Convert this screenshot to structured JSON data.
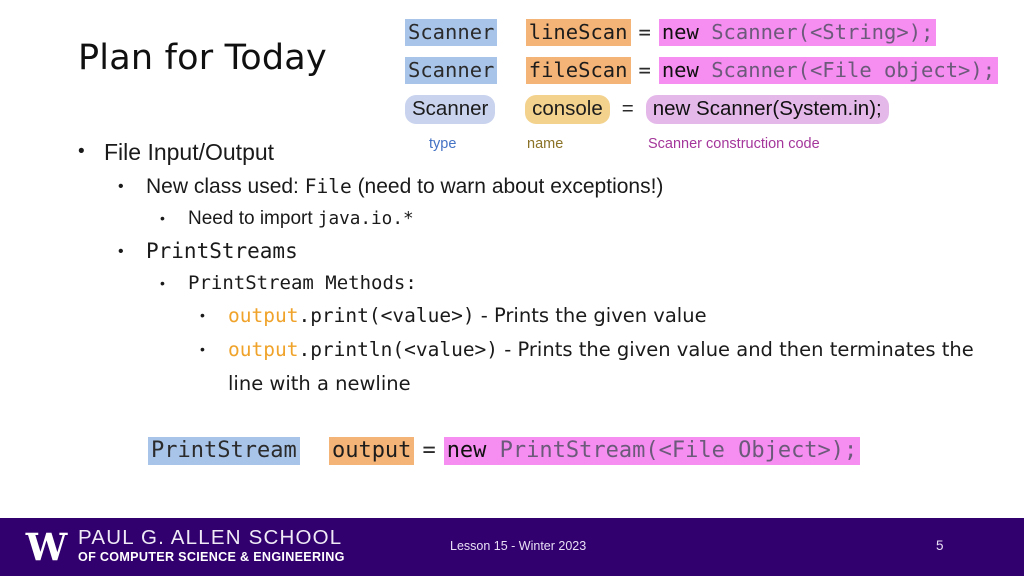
{
  "slide": {
    "title": "Plan for Today",
    "page_number": "5",
    "background_color": "#ffffff"
  },
  "code_diagram": {
    "rows": [
      {
        "type": "Scanner",
        "name": "lineScan",
        "equals": "=",
        "code_keyword": "new ",
        "code_rest": "Scanner(<String>);",
        "style": "mono"
      },
      {
        "type": "Scanner",
        "name": "fileScan",
        "equals": "=",
        "code_keyword": "new ",
        "code_rest": "Scanner(<File object>);",
        "style": "mono"
      },
      {
        "type": "Scanner",
        "name": "console",
        "equals": "=",
        "code_keyword": "new ",
        "code_rest": "Scanner(System.in);",
        "style": "sans"
      }
    ],
    "legend": {
      "type_label": "type",
      "name_label": "name",
      "code_label": "Scanner construction code",
      "type_color": "#4472c4",
      "name_color": "#8a7227",
      "code_color": "#a4369b"
    },
    "colors": {
      "type_highlight": "#a9c4e9",
      "name_highlight": "#f5b477",
      "code_highlight": "#f68df0",
      "type_highlight_soft": "#c9d3ee",
      "name_highlight_soft": "#f3d28e",
      "code_highlight_soft": "#e5b8ea"
    }
  },
  "bullets": {
    "b1_text": "File Input/Output",
    "b2_pre": "New class used: ",
    "b2_code": "File",
    "b2_post": " (need to warn about exceptions!)",
    "b3_pre": "Need to import ",
    "b3_code": "java.io.*",
    "b4_text": "PrintStreams",
    "b5_text": "PrintStream Methods:",
    "b6_out": "output",
    "b6_sig": ".print(<value>)",
    "b6_desc": " -  Prints the given value",
    "b7_out": "output",
    "b7_sig": ".println(<value>)",
    "b7_desc": " - Prints the given value and then terminates the line with a newline",
    "dot": "•"
  },
  "bottom_code": {
    "type": "PrintStream",
    "name": "output",
    "equals": "=",
    "code_keyword": "new ",
    "code_rest": "PrintStream(<File Object>);"
  },
  "footer": {
    "logo_letter": "W",
    "school_line1": "PAUL G. ALLEN SCHOOL",
    "school_line2": "OF COMPUTER SCIENCE & ENGINEERING",
    "lesson": "Lesson 15 - Winter 2023",
    "page": "5",
    "background_color": "#32006e"
  }
}
